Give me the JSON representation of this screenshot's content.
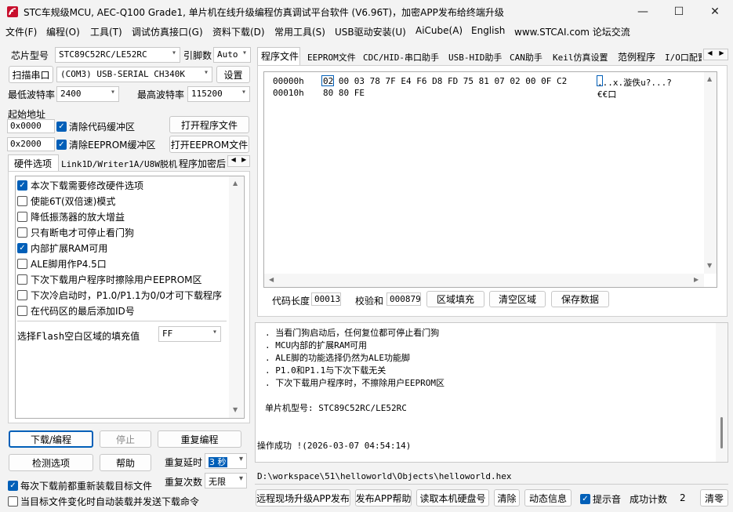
{
  "window": {
    "title": "STC车规级MCU, AEC-Q100 Grade1, 单片机在线升级编程仿真调试平台软件 (V6.96T)，加密APP发布给终端升级",
    "minimize": "—",
    "maximize": "☐",
    "close": "✕"
  },
  "menu": [
    "文件(F)",
    "编程(O)",
    "工具(T)",
    "调试仿真接口(G)",
    "资料下载(D)",
    "常用工具(S)",
    "USB驱动安装(U)",
    "AiCube(A)",
    "English",
    "www.STCAI.com 论坛交流"
  ],
  "left": {
    "chip_label": "芯片型号",
    "chip_value": "STC89C52RC/LE52RC",
    "pins_label": "引脚数",
    "pins_value": "Auto",
    "scan_button": "扫描串口",
    "port_value": "(COM3) USB-SERIAL CH340K",
    "settings_button": "设置",
    "min_baud_label": "最低波特率",
    "min_baud_value": "2400",
    "max_baud_label": "最高波特率",
    "max_baud_value": "115200",
    "start_addr_label": "起始地址",
    "code_addr": "0x0000",
    "clear_code_label": "清除代码缓冲区",
    "open_program_button": "打开程序文件",
    "eeprom_addr": "0x2000",
    "clear_eeprom_label": "清除EEPROM缓冲区",
    "open_eeprom_button": "打开EEPROM文件",
    "tabs": [
      "硬件选项",
      "Link1D/Writer1A/U8W脱机",
      "程序加密后"
    ],
    "hw_options": [
      {
        "label": "本次下载需要修改硬件选项",
        "checked": true
      },
      {
        "label": "使能6T(双倍速)模式",
        "checked": false
      },
      {
        "label": "降低振荡器的放大增益",
        "checked": false
      },
      {
        "label": "只有断电才可停止看门狗",
        "checked": false
      },
      {
        "label": "内部扩展RAM可用",
        "checked": true
      },
      {
        "label": "ALE脚用作P4.5口",
        "checked": false
      },
      {
        "label": "下次下载用户程序时擦除用户EEPROM区",
        "checked": false
      },
      {
        "label": "下次冷启动时，P1.0/P1.1为0/0才可下载程序",
        "checked": false
      },
      {
        "label": "在代码区的最后添加ID号",
        "checked": false
      }
    ],
    "fill_label": "选择Flash空白区域的填充值",
    "fill_value": "FF",
    "download_button": "下载/编程",
    "stop_button": "停止",
    "reprogram_button": "重复编程",
    "detect_button": "检测选项",
    "help_button": "帮助",
    "repeat_delay_label": "重复延时",
    "repeat_delay_value": "3 秒",
    "repeat_count_label": "重复次数",
    "repeat_count_value": "无限",
    "reload_label": "每次下载前都重新装载目标文件",
    "auto_load_label": "当目标文件变化时自动装载并发送下载命令"
  },
  "right": {
    "tabs": [
      "程序文件",
      "EEPROM文件",
      "CDC/HID-串口助手",
      "USB-HID助手",
      "CAN助手",
      "Keil仿真设置",
      "范例程序",
      "I/O口配置"
    ],
    "hex_rows": [
      {
        "addr": "00000h",
        "bytes": "02 00 03 78 7F E4 F6 D8 FD 75 81 07 02 00 0F C2",
        "ascii": "...x.漩佚u?...?"
      },
      {
        "addr": "00010h",
        "bytes": "80 80 FE",
        "ascii": "€€口"
      }
    ],
    "code_len_label": "代码长度",
    "code_len_value": "00013",
    "checksum_label": "校验和",
    "checksum_value": "000879",
    "fill_area_button": "区域填充",
    "clear_area_button": "清空区域",
    "save_button": "保存数据",
    "log_lines": [
      ". 当看门狗启动后，任何复位都可停止看门狗",
      ". MCU内部的扩展RAM可用",
      ". ALE脚的功能选择仍然为ALE功能脚",
      ". P1.0和P1.1与下次下载无关",
      ". 下次下载用户程序时，不擦除用户EEPROM区",
      "单片机型号: STC89C52RC/LE52RC",
      "操作成功 !(2026-03-07 04:54:14)"
    ],
    "file_path": "D:\\workspace\\51\\helloworld\\Objects\\helloworld.hex",
    "remote_button": "远程现场升级APP发布",
    "publish_help_button": "发布APP帮助",
    "read_disk_button": "读取本机硬盘号",
    "clear_button": "清除",
    "dynamic_button": "动态信息",
    "tone_label": "提示音",
    "success_count_label": "成功计数",
    "success_count_value": "2",
    "clear_zero_button": "清零"
  }
}
